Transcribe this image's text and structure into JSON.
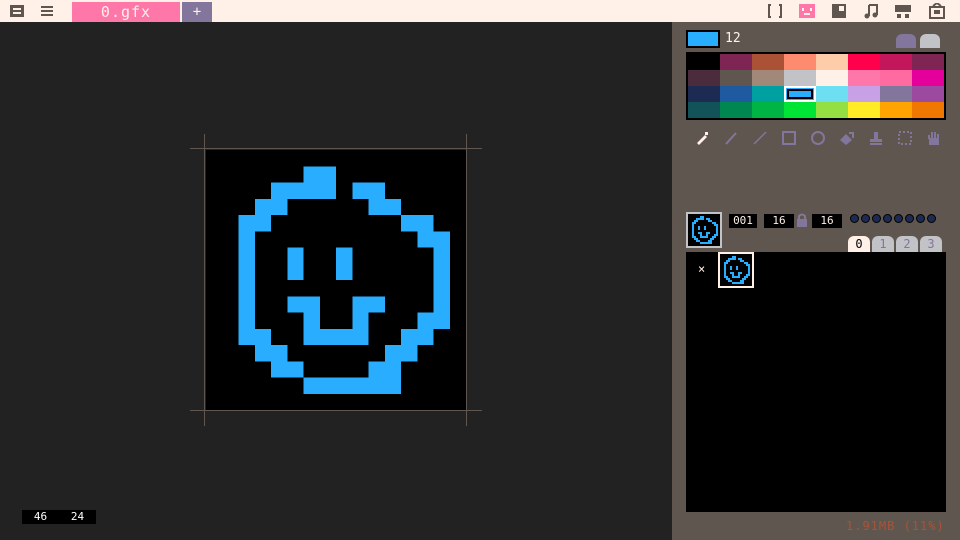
{
  "toolbar": {
    "file_tab_label": "0.gfx",
    "add_tab_label": "+",
    "left_icons": [
      "app-switch-icon",
      "menu-icon"
    ],
    "right_icons": [
      "code-icon",
      "sprite-icon",
      "map-icon",
      "sfx-icon",
      "music-icon",
      "cartridge-icon"
    ]
  },
  "canvas": {
    "cursor_x": "46",
    "cursor_y": "24",
    "sprite_pixels": [
      "................",
      "......##........",
      "....####.##.....",
      "...##.....##....",
      "..##........##..",
      "..#..........##.",
      "..#..#..#.....#.",
      "..#..#..#.....#.",
      "..#...........#.",
      "..#..##..##...#.",
      "..#...#..#...##.",
      "..##..####..##..",
      "...##......##...",
      "....##....##....",
      "......######....",
      "................"
    ],
    "sprite_color": "#29adff"
  },
  "palette": {
    "selected_index": "12",
    "colors": [
      "#000000",
      "#7e2553",
      "#ab5236",
      "#ff8b6e",
      "#ffccaa",
      "#ff004d",
      "#c2185b",
      "#7e2553",
      "#4a2c3c",
      "#5f574f",
      "#a28879",
      "#c2c3c7",
      "#fff1e8",
      "#ff77a8",
      "#ff6ba1",
      "#e6009b",
      "#1d2b53",
      "#1e5aa0",
      "#00a0a0",
      "#29adff",
      "#6ce0f2",
      "#c8a0e6",
      "#83769c",
      "#9b4aa0",
      "#125359",
      "#008751",
      "#00b543",
      "#00e436",
      "#94e044",
      "#ffec27",
      "#ffa300",
      "#f07800"
    ],
    "selected_swatch": 19
  },
  "tools": [
    {
      "icon": "pencil-icon",
      "active": true
    },
    {
      "icon": "brush-icon",
      "active": false
    },
    {
      "icon": "line-icon",
      "active": false
    },
    {
      "icon": "rectangle-icon",
      "active": false
    },
    {
      "icon": "circle-icon",
      "active": false
    },
    {
      "icon": "fill-icon",
      "active": false
    },
    {
      "icon": "stamp-icon",
      "active": false
    },
    {
      "icon": "select-icon",
      "active": false
    },
    {
      "icon": "pan-icon",
      "active": false
    }
  ],
  "sprite_info": {
    "index": "001",
    "width": "16",
    "height": "16",
    "flags_count": 8
  },
  "banks": [
    "0",
    "1",
    "2",
    "3"
  ],
  "active_bank": "0",
  "sheet": {
    "empty_slot_label": "×"
  },
  "memory": "1.91MB (11%)"
}
